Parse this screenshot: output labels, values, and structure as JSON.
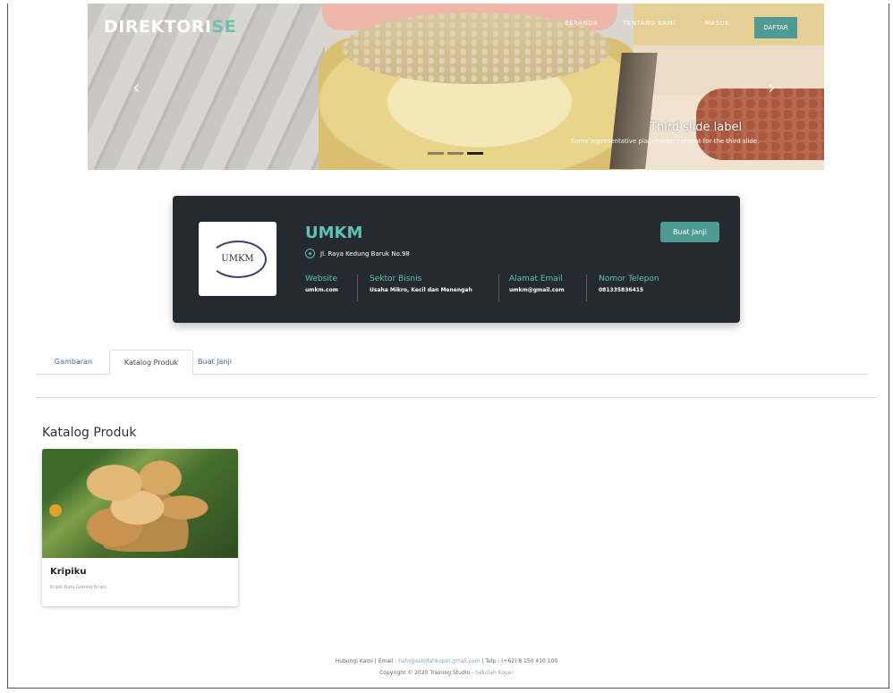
{
  "brand": {
    "name": "DIREKTORI",
    "suffix": "SE",
    "accent": "#6fbfb2"
  },
  "nav": {
    "items": [
      "BERANDA",
      "TENTANG KAMI",
      "MASUK"
    ],
    "register_label": "DAFTAR"
  },
  "carousel": {
    "caption_title": "Third slide label",
    "caption_text": "Some representative placeholder content for the third slide.",
    "prev_icon": "chevron-left-icon",
    "next_icon": "chevron-right-icon",
    "slide_count": 3,
    "active_slide": 3
  },
  "profile": {
    "logo_text": "UMKM",
    "name": "UMKM",
    "address": "Jl. Raya Kedung Baruk No.98",
    "button_label": "Buat Janji",
    "fields": [
      {
        "label": "Website",
        "value": "umkm.com"
      },
      {
        "label": "Sektor Bisnis",
        "value": "Usaha Mikro, Kecil dan Menengah"
      },
      {
        "label": "Alamat Email",
        "value": "umkm@gmail.com"
      },
      {
        "label": "Nomor Telepon",
        "value": "081335836415"
      }
    ]
  },
  "tabs": [
    {
      "label": "Gambaran",
      "active": false
    },
    {
      "label": "Katalog Produk",
      "active": true
    },
    {
      "label": "Buat Janji",
      "active": false
    }
  ],
  "catalog": {
    "title": "Katalog Produk",
    "products": [
      {
        "name": "Kripiku",
        "description": "Kripik Batu Gorong Krispi"
      }
    ]
  },
  "footer": {
    "contact_prefix": "Hubungi Kami | Email :",
    "email": "halo@sekolahkoper.gmail.com",
    "phone": "| Telp : (+62) 8 150 410 100",
    "copyright": "Copyright © 2020 Training Studio -",
    "copyright_link": "Sekolah Koper"
  },
  "colors": {
    "teal": "#4f9a92",
    "card_bg": "#252a30",
    "link": "#3a6fb7"
  }
}
